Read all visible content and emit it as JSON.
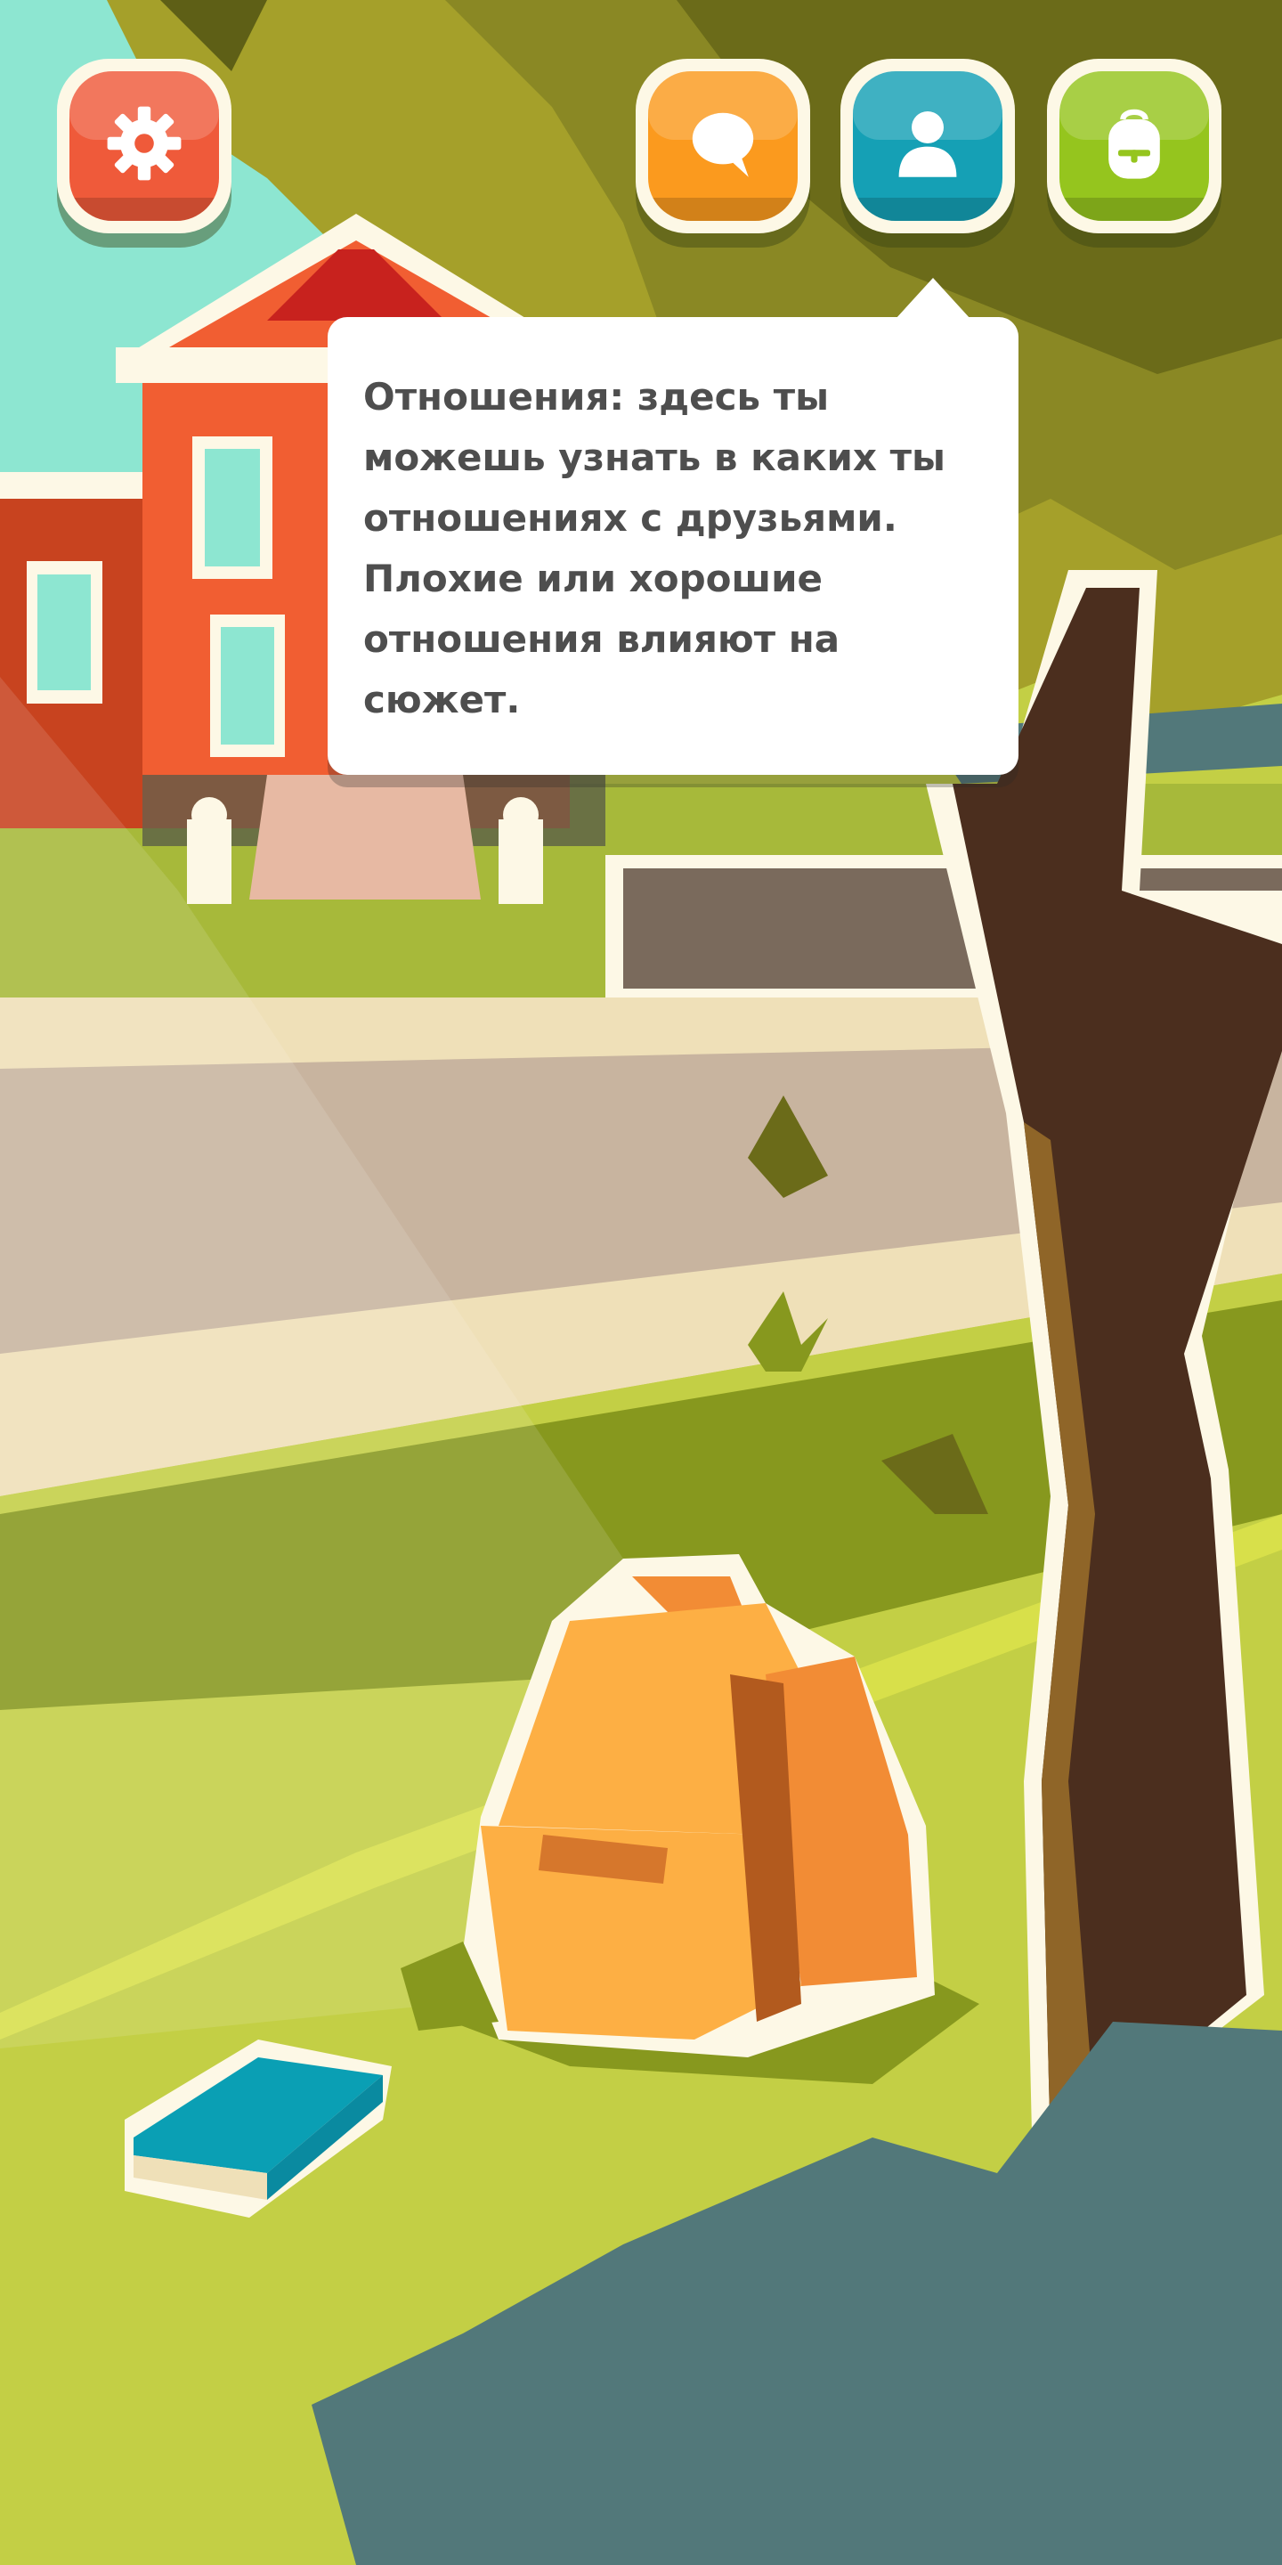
{
  "colors": {
    "sky": "#8de6d1",
    "school_brick": "#f15e32",
    "tree_canopy": "#7a7b1e",
    "tree_trunk": "#4b2e1e",
    "grass": "#c3cf45",
    "road": "#c8b49f",
    "sidewalk": "#efe0b8",
    "backpack": "#fdaf44",
    "book": "#0a9fb4",
    "boulder": "#52787a",
    "settings_button": "#ef5a3a",
    "chat_button": "#fb9a1e",
    "relationships_button": "#15a0b5",
    "backpack_button": "#95c51e"
  },
  "hud": {
    "settings": {
      "icon": "gear-icon"
    },
    "chat": {
      "icon": "speech-bubble-icon"
    },
    "relationships": {
      "icon": "user-icon"
    },
    "inventory": {
      "icon": "backpack-icon"
    }
  },
  "tooltip": {
    "text": "Отношения: здесь ты можешь узнать в каких ты отношениях с друзьями. Плохие или хорошие отношения влияют на сюжет."
  }
}
